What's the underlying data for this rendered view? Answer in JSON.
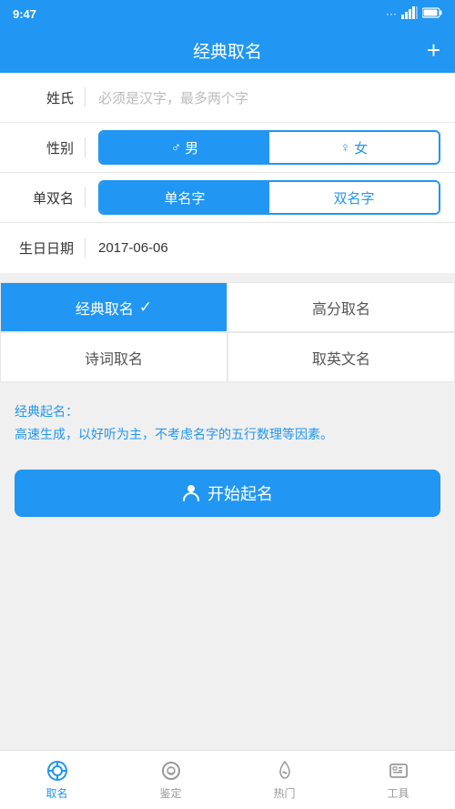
{
  "statusBar": {
    "time": "9:47",
    "signalDots": "···",
    "signalBars": "||||",
    "battery": "□"
  },
  "header": {
    "title": "经典取名",
    "addButton": "+"
  },
  "form": {
    "surnameLabel": "姓氏",
    "surnameDivider": "|",
    "surnamePlaceholder": "必须是汉字，最多两个字",
    "genderLabel": "性别",
    "genderMale": "♂ 男",
    "genderFemale": "♀ 女",
    "nameTypeLabel": "单双名",
    "nameSingle": "单名字",
    "nameDouble": "双名字",
    "birthdateLabel": "生日日期",
    "birthdateValue": "2017-06-06"
  },
  "nameTypes": [
    {
      "label": "经典取名",
      "active": true,
      "check": "✓"
    },
    {
      "label": "高分取名",
      "active": false
    },
    {
      "label": "诗词取名",
      "active": false
    },
    {
      "label": "取英文名",
      "active": false
    }
  ],
  "description": {
    "title": "经典起名：",
    "text": "高速生成，以好听为主，不考虑名字的五行数理等因素。"
  },
  "startButton": {
    "icon": "👤",
    "label": "开始起名"
  },
  "bottomNav": [
    {
      "label": "取名",
      "active": true
    },
    {
      "label": "鉴定",
      "active": false
    },
    {
      "label": "热门",
      "active": false
    },
    {
      "label": "工具",
      "active": false
    }
  ]
}
